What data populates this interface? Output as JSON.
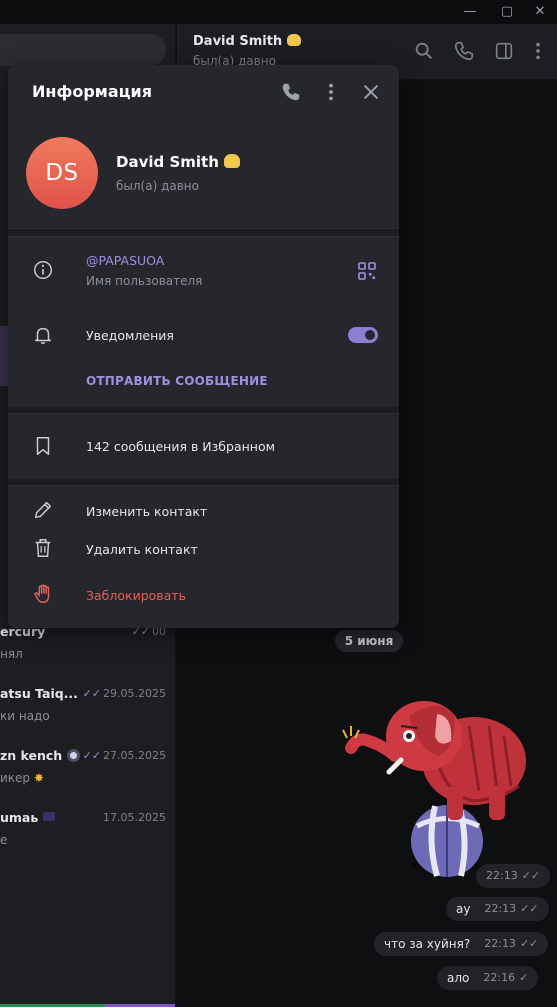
{
  "window": {
    "minimize_glyph": "—",
    "maximize_glyph": "▢",
    "close_glyph": "✕"
  },
  "sidebar": {
    "chats": [
      {
        "name": "ercury",
        "preview": "нял",
        "time": "00",
        "ticks": "✓✓"
      },
      {
        "name": "atsu Taiq...",
        "preview": "ки надо",
        "time": "29.05.2025",
        "ticks": "✓✓"
      },
      {
        "name": "zn kench",
        "preview": "икер",
        "time": "27.05.2025",
        "ticks": "✓✓"
      },
      {
        "name": "umaь",
        "preview": "е",
        "time": "17.05.2025",
        "ticks": ""
      }
    ]
  },
  "chat_header": {
    "title": "David Smith",
    "subtitle": "был(а) давно"
  },
  "info_panel": {
    "title": "Информация",
    "avatar_initials": "DS",
    "name": "David Smith",
    "status": "был(а) давно",
    "username": "@PAPASUOA",
    "username_label": "Имя пользователя",
    "notifications_label": "Уведомления",
    "notifications_on": true,
    "send_message": "ОТПРАВИТЬ СООБЩЕНИЕ",
    "saved_messages": "142 сообщения в Избранном",
    "edit_contact": "Изменить контакт",
    "delete_contact": "Удалить контакт",
    "block": "Заблокировать"
  },
  "messages": {
    "date_separator": "5 июня",
    "items": [
      {
        "text": "",
        "time": "22:13",
        "check": "✓✓"
      },
      {
        "text": "ау",
        "time": "22:13",
        "check": "✓✓"
      },
      {
        "text": "что за хуйня?",
        "time": "22:13",
        "check": "✓✓"
      },
      {
        "text": "ало",
        "time": "22:16",
        "check": "✓"
      }
    ]
  },
  "colors": {
    "accent": "#a08fe0",
    "danger": "#e5605a",
    "panel_bg": "#25272c",
    "avatar": "#e8604e"
  }
}
